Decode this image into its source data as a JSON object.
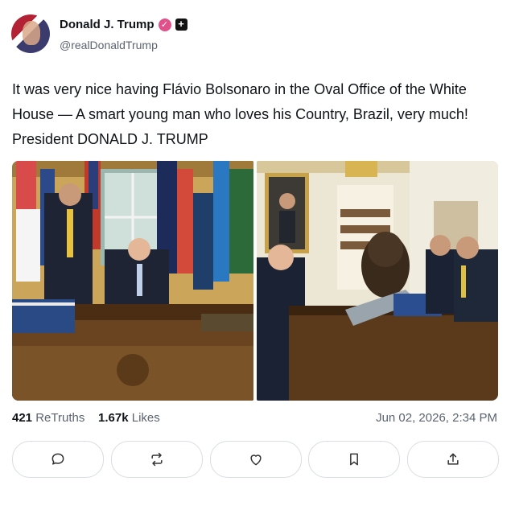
{
  "author": {
    "display_name": "Donald J. Trump",
    "handle": "@realDonaldTrump",
    "verified_icon": "verified-badge-icon",
    "extra_badge_icon": "plus-badge-icon"
  },
  "post": {
    "text": "It was very nice having Flávio Bolsonaro in the Oval Office of the White House — A smart young man who loves his Country, Brazil, very much! President DONALD J. TRUMP",
    "images": [
      {
        "name": "photo-oval-office-desk"
      },
      {
        "name": "photo-oval-office-meeting"
      }
    ]
  },
  "stats": {
    "retruths_count": "421",
    "retruths_label": "ReTruths",
    "likes_count": "1.67k",
    "likes_label": "Likes",
    "timestamp": "Jun 02, 2026, 2:34 PM"
  },
  "actions": [
    "comment-icon",
    "retruth-icon",
    "like-icon",
    "bookmark-icon",
    "share-icon"
  ],
  "colors": {
    "verified_badge": "#e2508a",
    "text_primary": "#0f1419",
    "text_secondary": "#5b6470",
    "border": "#d9dde3"
  }
}
